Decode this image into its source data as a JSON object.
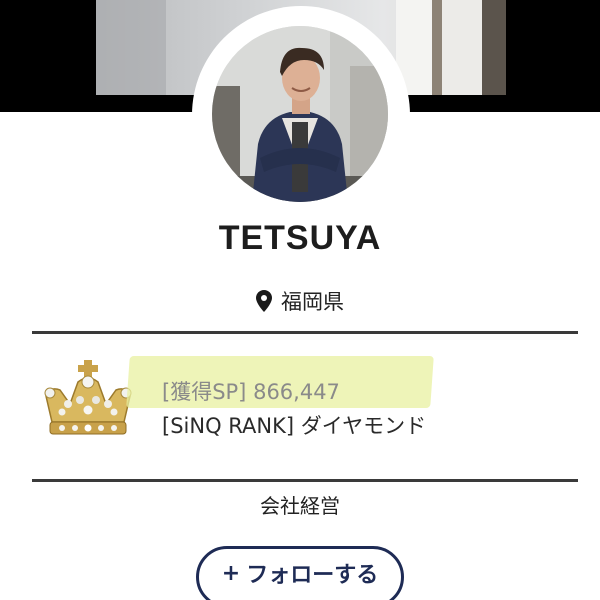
{
  "profile": {
    "username": "TETSUYA",
    "location": "福岡県",
    "location_icon": "map-pin-icon",
    "occupation": "会社経営"
  },
  "stats": {
    "sp_label": "[獲得SP]",
    "sp_value": "866,447",
    "rank_label": "[SiNQ RANK]",
    "rank_value": "ダイヤモンド",
    "rank_icon": "crown-icon"
  },
  "actions": {
    "follow_icon": "+",
    "follow_label": "フォローする"
  },
  "colors": {
    "follow_accent": "#1e2b55",
    "highlight": "#e8f0a0",
    "divider": "#3a3a3a"
  }
}
